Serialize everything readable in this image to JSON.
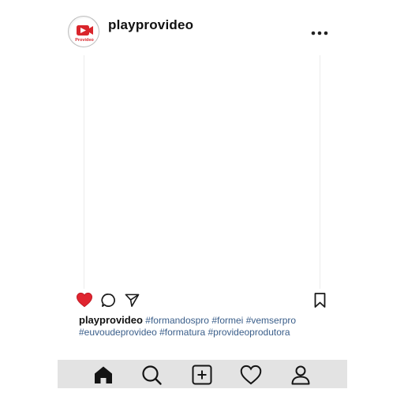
{
  "post": {
    "username": "playprovideo",
    "avatar": {
      "logo_text": "Provideo",
      "icon": "video-camera-icon",
      "accent": "#d9252b"
    },
    "liked": true,
    "like_color": "#e0242f"
  },
  "caption": {
    "username": "playprovideo",
    "hashtags": [
      "#formandospro",
      "#formei",
      "#vemserpro",
      "#euvoudeprovideo",
      "#formatura",
      "#provideoprodutora"
    ],
    "hashtag_color": "#3a5e8a"
  },
  "actions": [
    "heart-icon",
    "comment-icon",
    "share-icon",
    "bookmark-icon",
    "more-icon"
  ],
  "bottom_nav": {
    "items": [
      "home-icon",
      "search-icon",
      "add-post-icon",
      "activity-heart-icon",
      "profile-icon"
    ],
    "background": "#e3e3e3"
  }
}
